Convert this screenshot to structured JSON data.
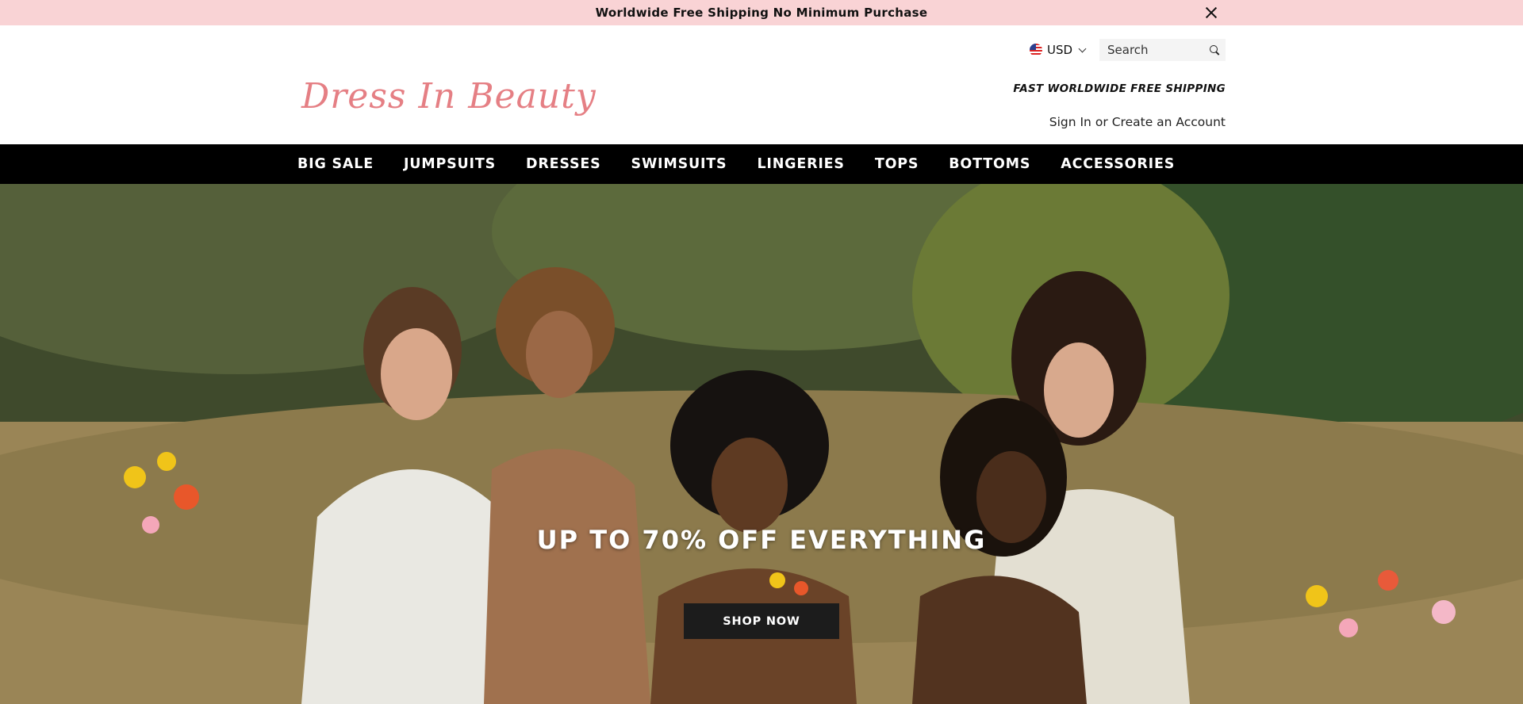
{
  "announcement": {
    "text": "Worldwide Free Shipping No Minimum Purchase",
    "close_icon": "close-icon"
  },
  "header": {
    "logo_text": "Dress In Beauty",
    "currency": "USD",
    "search": {
      "placeholder": "Search"
    },
    "tagline": "FAST WORLDWIDE FREE SHIPPING",
    "account": {
      "sign_in": "Sign In",
      "or": "or",
      "create": "Create an Account"
    }
  },
  "nav": {
    "items": [
      {
        "label": "BIG SALE"
      },
      {
        "label": "JUMPSUITS"
      },
      {
        "label": "DRESSES"
      },
      {
        "label": "SWIMSUITS"
      },
      {
        "label": "LINGERIES"
      },
      {
        "label": "TOPS"
      },
      {
        "label": "BOTTOMS"
      },
      {
        "label": "ACCESSORIES"
      }
    ]
  },
  "hero": {
    "headline": "UP TO 70% OFF EVERYTHING",
    "button_label": "SHOP NOW"
  },
  "colors": {
    "announcement_bg": "#f9d3d5",
    "logo": "#e57f84",
    "nav_bg": "#000000",
    "button_bg": "#1c1c1c"
  }
}
